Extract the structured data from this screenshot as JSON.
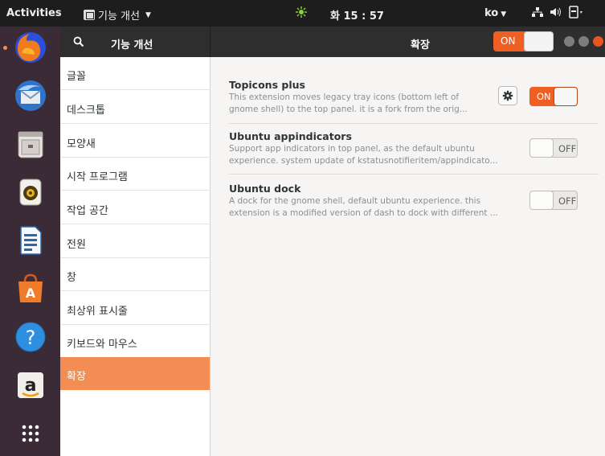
{
  "topbar": {
    "activities": "Activities",
    "app_menu_label": "기능 개선",
    "clock": "화 15 : 57",
    "lang": "ko"
  },
  "dock": {
    "apps": [
      {
        "name": "firefox-icon"
      },
      {
        "name": "thunderbird-icon"
      },
      {
        "name": "files-icon"
      },
      {
        "name": "rhythmbox-icon"
      },
      {
        "name": "writer-icon"
      },
      {
        "name": "software-icon"
      },
      {
        "name": "help-icon"
      },
      {
        "name": "amazon-icon"
      },
      {
        "name": "show-apps-icon"
      }
    ]
  },
  "header": {
    "left_title": "기능 개선",
    "main_title": "확장",
    "master_switch": "ON"
  },
  "sidebar": {
    "items": [
      {
        "label": "글꼴"
      },
      {
        "label": "데스크톱"
      },
      {
        "label": "모양새"
      },
      {
        "label": "시작 프로그램"
      },
      {
        "label": "작업 공간"
      },
      {
        "label": "전원"
      },
      {
        "label": "창"
      },
      {
        "label": "최상위 표시줄"
      },
      {
        "label": "키보드와 마우스"
      },
      {
        "label": "확장"
      }
    ],
    "active_index": 9
  },
  "extensions": [
    {
      "title": "Topicons plus",
      "desc1": "This extension moves legacy tray icons (bottom left of",
      "desc2": "gnome shell) to the top panel. it is a fork from the orig...",
      "state": "ON",
      "has_settings": true
    },
    {
      "title": "Ubuntu appindicators",
      "desc1": "Support app indicators in top panel, as the default ubuntu",
      "desc2": "experience. system update of kstatusnotifieritem/appindicato...",
      "state": "OFF",
      "has_settings": false
    },
    {
      "title": "Ubuntu dock",
      "desc1": "A dock for the gnome shell, default ubuntu experience. this",
      "desc2": "extension is a modified version of dash to dock with different ...",
      "state": "OFF",
      "has_settings": false
    }
  ],
  "colors": {
    "accent": "#f05f22",
    "sidebar_active": "#f48d53",
    "dock_bg": "#3b2b36",
    "header_bg": "#2e2e2e"
  }
}
